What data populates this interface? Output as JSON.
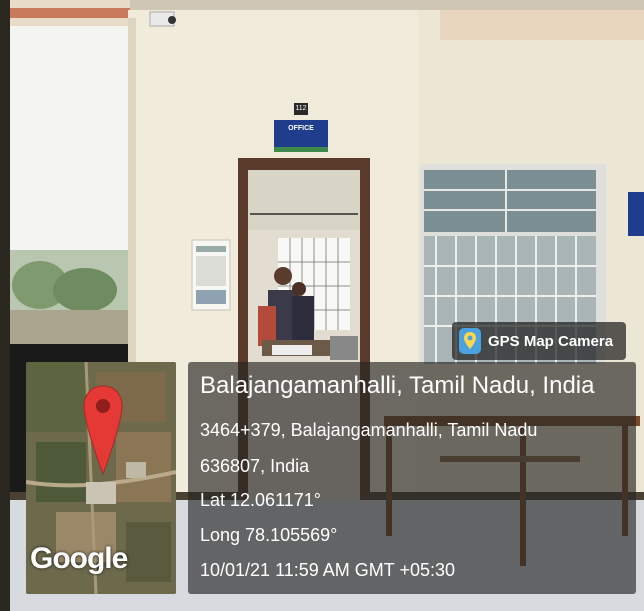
{
  "photo": {
    "room_number": "112",
    "door_sign": "OFFICE"
  },
  "overlay": {
    "app_name": "GPS Map Camera",
    "map_brand": "Google",
    "location_title": "Balajangamanhalli, Tamil Nadu, India",
    "address_line1": "3464+379, Balajangamanhalli, Tamil Nadu",
    "address_line2": "636807, India",
    "latitude": "Lat 12.061171°",
    "longitude": "Long 78.105569°",
    "timestamp": "10/01/21 11:59 AM GMT +05:30"
  },
  "icons": [
    "map-pin-icon",
    "gps-app-icon"
  ],
  "colors": {
    "pin_red": "#e53935",
    "sign_blue": "#1f3d8c",
    "wall": "#ece6d4",
    "floor": "#d7dbe0"
  }
}
